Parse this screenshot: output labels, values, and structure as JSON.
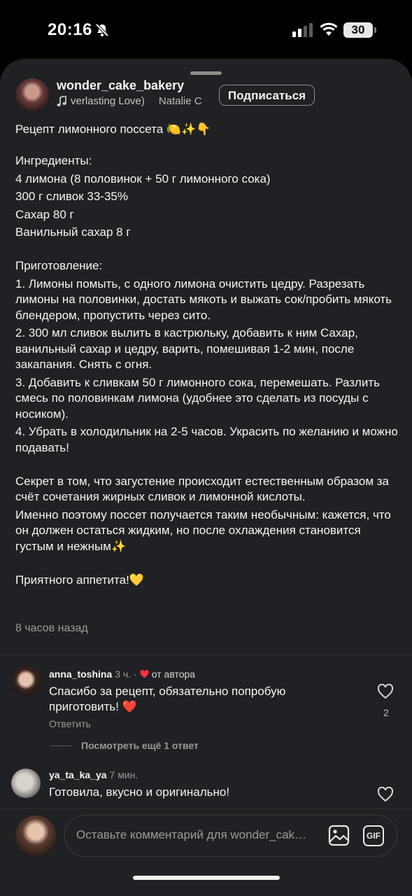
{
  "status": {
    "time": "20:16",
    "battery": "30"
  },
  "post": {
    "username": "wonder_cake_bakery",
    "music_title": "verlasting Love)",
    "music_artist": "Natalie C",
    "follow_label": "Подписаться",
    "title_line": "Рецепт лимонного поссета 🍋✨👇",
    "ingredients_heading": "Ингредиенты:",
    "ingredients": [
      "4 лимона (8 половинок + 50 г лимонного сока)",
      "300 г сливок 33-35%",
      "Сахар 80 г",
      "Ванильный сахар 8 г"
    ],
    "steps_heading": "Приготовление:",
    "steps": [
      "1. Лимоны помыть, с одного лимона очистить цедру. Разрезать лимоны на половинки, достать мякоть и выжать сок/пробить мякоть блендером, пропустить через сито.",
      "2. 300 мл сливок вылить в кастрюльку, добавить к ним Сахар, ванильный сахар и цедру, варить, помешивая 1-2 мин, после закапания. Снять с огня.",
      "3. Добавить к сливкам 50 г лимонного сока, перемешать. Разлить смесь по половинкам лимона (удобнее это сделать из посуды с носиком).",
      "4. Убрать в холодильник на 2-5 часов. Украсить по желанию и можно подавать!"
    ],
    "secret_1": "Секрет в том, что загустение происходит естественным образом за счёт сочетания жирных сливок и лимонной кислоты.",
    "secret_2": "Именно поэтому поссет получается таким необычным: кажется, что он должен остаться жидким, но после охлаждения становится густым и нежным✨",
    "closing": "Приятного аппетита!💛",
    "time_ago": "8 часов назад"
  },
  "comments": [
    {
      "username": "anna_toshina",
      "time": "3 ч.",
      "separator": "·",
      "author_like": "от автора",
      "text": "Спасибо за рецепт, обязательно попробую приготовить! ❤️",
      "reply_label": "Ответить",
      "likes": "2",
      "more_replies": "Посмотреть ещё 1 ответ"
    },
    {
      "username": "ya_ta_ka_ya",
      "time": "7 мин.",
      "text": "Готовила, вкусно и оригинально!"
    }
  ],
  "composer": {
    "placeholder": "Оставьте комментарий для wonder_cake_bakery...",
    "gif_label": "GIF"
  },
  "icons": {
    "bell": "bell-slash-icon",
    "signal": "cellular-signal-icon",
    "wifi": "wifi-icon",
    "music": "music-note-icon",
    "heart": "heart-icon",
    "image": "image-icon"
  },
  "colors": {
    "sheet_bg": "#202124",
    "heart_red": "#ff3040"
  }
}
